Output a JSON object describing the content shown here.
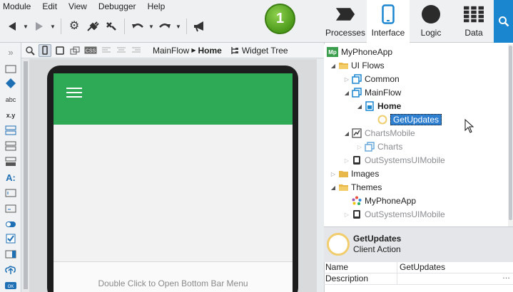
{
  "menu": [
    "Module",
    "Edit",
    "View",
    "Debugger",
    "Help"
  ],
  "publish_badge": "1",
  "tabs": [
    {
      "label": "Processes",
      "icon": "processes-icon"
    },
    {
      "label": "Interface",
      "icon": "phone-icon",
      "active": true
    },
    {
      "label": "Logic",
      "icon": "logic-circle-icon"
    },
    {
      "label": "Data",
      "icon": "data-grid-icon"
    }
  ],
  "editor": {
    "breadcrumb_flow": "MainFlow",
    "breadcrumb_screen": "Home",
    "widget_tree_label": "Widget Tree",
    "bottom_bar_hint": "Double Click to Open Bottom Bar Menu"
  },
  "tree": {
    "root": "MyPhoneApp",
    "root_badge": "Mp",
    "ui_flows": "UI Flows",
    "common": "Common",
    "mainflow": "MainFlow",
    "home": "Home",
    "getupdates": "GetUpdates",
    "chartsmobile": "ChartsMobile",
    "charts": "Charts",
    "outsystems1": "OutSystemsUIMobile",
    "images": "Images",
    "themes": "Themes",
    "theme_app": "MyPhoneApp",
    "outsystems2": "OutSystemsUIMobile"
  },
  "properties": {
    "title": "GetUpdates",
    "subtitle": "Client Action",
    "rows": [
      {
        "key": "Name",
        "value": "GetUpdates"
      },
      {
        "key": "Description",
        "value": ""
      }
    ]
  },
  "colors": {
    "header_green": "#2eaa57",
    "accent_blue": "#1a86d0",
    "selection_blue": "#2f7fd1",
    "badge_green": "#4c9a1a",
    "folder_yellow": "#e9b84a"
  }
}
